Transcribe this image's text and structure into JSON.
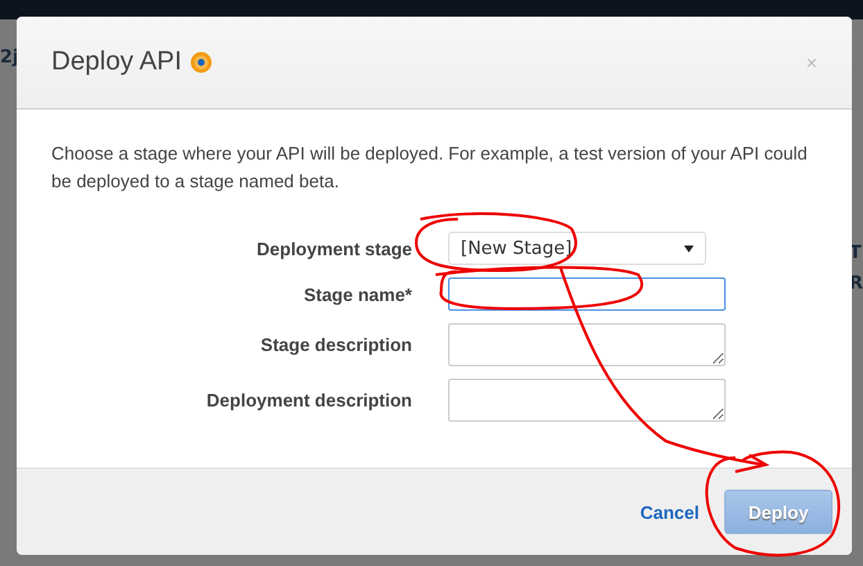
{
  "background": {
    "fragments": [
      {
        "text": "2j",
        "kind": "left"
      },
      {
        "text": "T",
        "kind": "right"
      },
      {
        "text": "R",
        "kind": "right"
      }
    ]
  },
  "dialog": {
    "title": "Deploy API",
    "close": "×",
    "intro": "Choose a stage where your API will be deployed. For example, a test version of your API could be deployed to a stage named beta.",
    "fields": [
      {
        "label": "Deployment stage",
        "kind": "select",
        "value": "[New Stage]",
        "focused": false
      },
      {
        "label": "Stage name*",
        "kind": "input",
        "focused": true
      },
      {
        "label": "Stage description",
        "kind": "textarea",
        "focused": false
      },
      {
        "label": "Deployment description",
        "kind": "textarea",
        "focused": false
      }
    ],
    "cancel": "Cancel",
    "deploy": {
      "label": "Deploy",
      "disabled": true
    }
  }
}
